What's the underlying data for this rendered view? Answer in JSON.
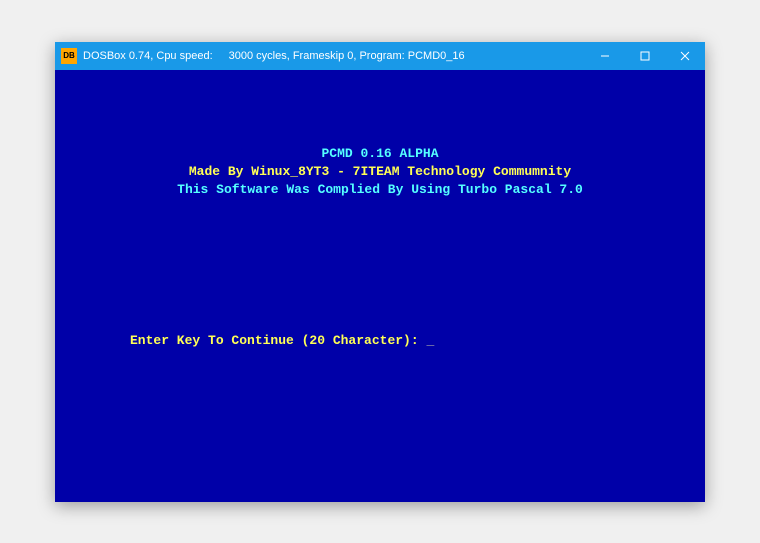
{
  "window": {
    "titlebar": {
      "icon_text": "DOS\nBOX",
      "title_part1": "DOSBox 0.74, Cpu speed:",
      "title_part2": "3000 cycles, Frameskip  0, Program: PCMD0_16"
    }
  },
  "dos": {
    "title": "PCMD 0.16 ALPHA",
    "author": "Made By Winux_8YT3 - 7ITEAM Technology Commumnity",
    "compile": "This Software Was Complied By Using Turbo Pascal 7.0",
    "prompt": "Enter Key To Continue (20 Character): ",
    "cursor": "_"
  }
}
